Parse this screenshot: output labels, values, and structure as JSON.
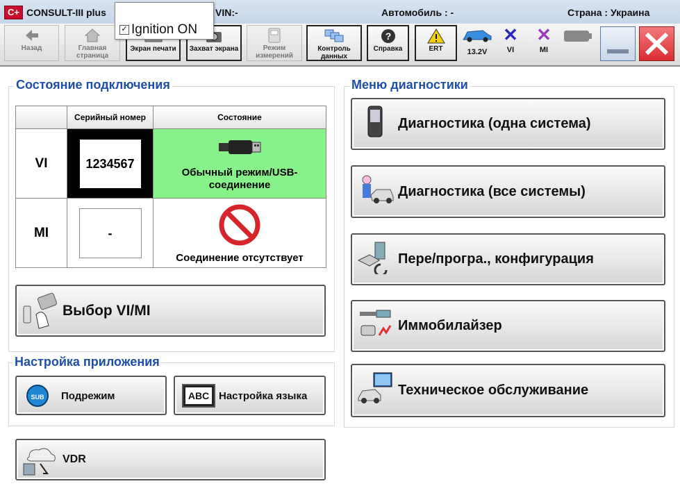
{
  "window": {
    "app_title": "CONSULT-III plus",
    "vin": "VIN:-",
    "vehicle": "Автомобиль : -",
    "country": "Страна : Украина",
    "logo_text": "C+"
  },
  "toolbar": {
    "back": "Назад",
    "home": "Главная страница",
    "print": "Экран печати",
    "capture": "Захват экрана",
    "measure": "Режим измерений",
    "data_control": "Контроль данных",
    "help": "Справка",
    "ert": "ERT",
    "voltage": "13.2V",
    "vi": "VI",
    "mi": "MI"
  },
  "ignition": {
    "label": "Ignition ON",
    "checked": true
  },
  "connection": {
    "title": "Состояние подключения",
    "headers": [
      "",
      "Серийный номер",
      "Состояние"
    ],
    "rows": [
      {
        "device": "VI",
        "serial": "1234567",
        "status": "Обычный режим/USB-соединение",
        "status_color": "#88f28a"
      },
      {
        "device": "MI",
        "serial": "-",
        "status": "Соединение отсутствует",
        "status_color": "#ffffff"
      }
    ],
    "select_button": "Выбор VI/MI"
  },
  "app_settings": {
    "title": "Настройка приложения",
    "submode": "Подрежим",
    "language": "Настройка языка",
    "sub_icon_text": "SUB",
    "abc_icon_text": "ABC"
  },
  "vdr": {
    "label": "VDR"
  },
  "diag_menu": {
    "title": "Меню диагностики",
    "items": [
      {
        "label": "Диагностика (одна система)",
        "icon": "handheld-device-icon"
      },
      {
        "label": "Диагностика (все системы)",
        "icon": "mechanic-car-icon"
      },
      {
        "label": "Пере/програ., конфигурация",
        "icon": "reprogramming-icon"
      },
      {
        "label": "Иммобилайзер",
        "icon": "key-immobilizer-icon"
      },
      {
        "label": "Техническое обслуживание",
        "icon": "maintenance-monitor-icon"
      }
    ]
  },
  "colors": {
    "accent_blue": "#1f4fa8",
    "vi_ok_green": "#88f28a",
    "close_red": "#e0393e",
    "status_x": "#2a2ab8",
    "status_x_mi": "#9b3bbf"
  }
}
